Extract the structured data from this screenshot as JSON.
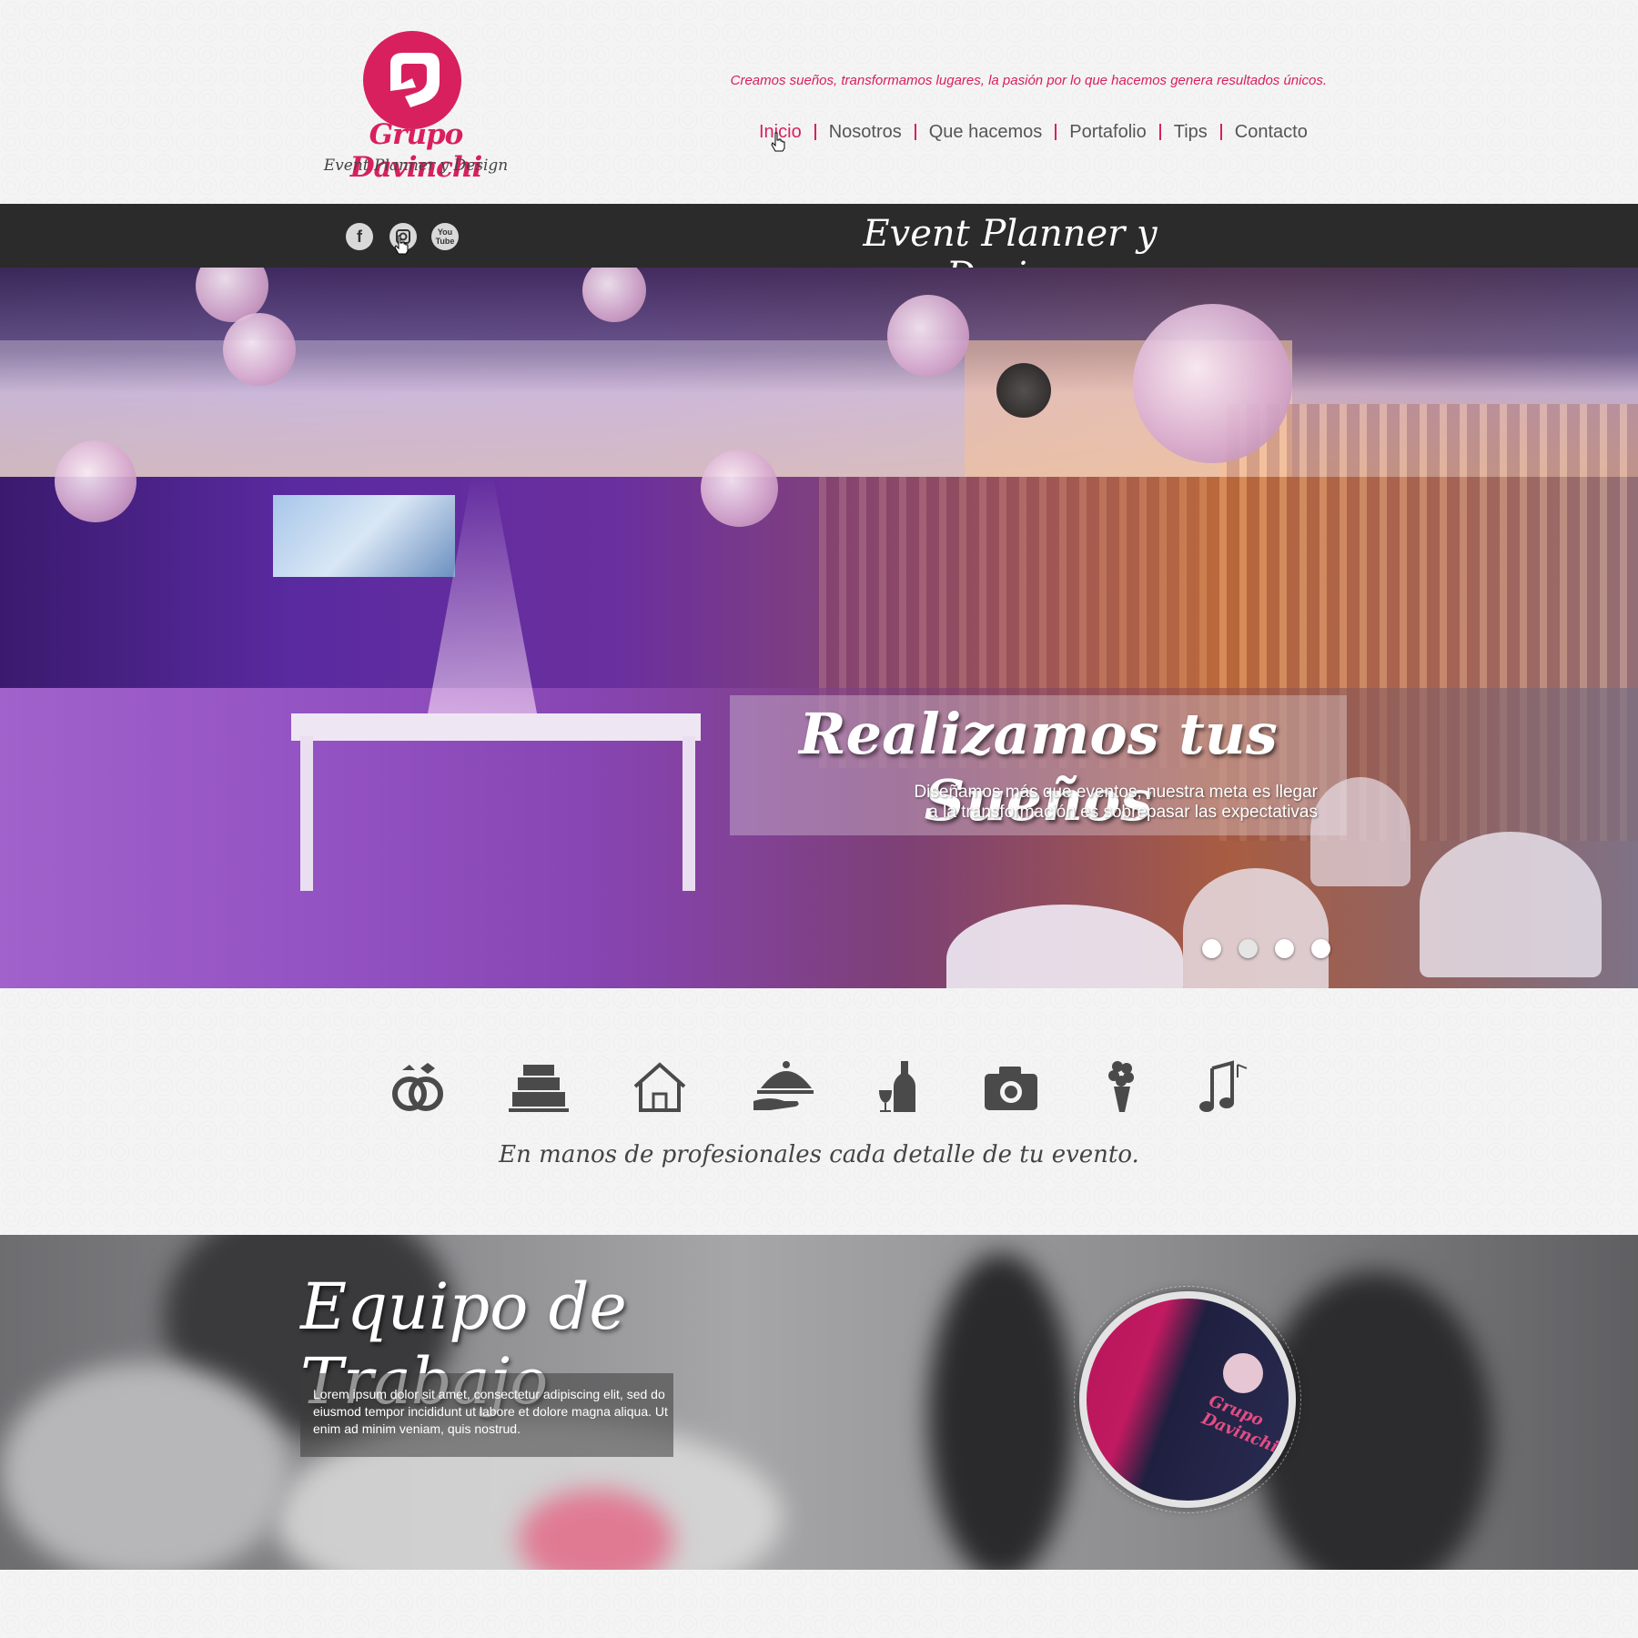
{
  "brand": {
    "name": "Grupo Davinchi",
    "subtitle": "Event Planner y Design",
    "accent_color": "#d8205f"
  },
  "header": {
    "tagline": "Creamos sueños, transformamos lugares, la pasión por lo que hacemos genera resultados únicos.",
    "nav": [
      {
        "label": "Inicio",
        "active": true
      },
      {
        "label": "Nosotros",
        "active": false
      },
      {
        "label": "Que hacemos",
        "active": false
      },
      {
        "label": "Portafolio",
        "active": false
      },
      {
        "label": "Tips",
        "active": false
      },
      {
        "label": "Contacto",
        "active": false
      }
    ]
  },
  "topbar": {
    "title": "Event  Planner y Design",
    "social": [
      {
        "icon": "facebook-icon",
        "glyph": "f"
      },
      {
        "icon": "instagram-icon",
        "glyph": ""
      },
      {
        "icon": "youtube-icon",
        "glyph": "You Tube"
      }
    ]
  },
  "hero": {
    "title": "Realizamos tus Sueños",
    "text_line1": "Diseñamos más que eventos, nuestra meta es llegar",
    "text_line2": "a la transformación es sobrepasar las expectativas",
    "slides": 4,
    "active_slide": 0
  },
  "services": {
    "icons": [
      "wedding-rings-icon",
      "cake-icon",
      "house-icon",
      "catering-cloche-icon",
      "wine-icon",
      "camera-icon",
      "flowers-icon",
      "music-icon"
    ],
    "caption": "En manos de profesionales cada detalle de tu evento."
  },
  "team": {
    "title": "Equipo de Trabajo",
    "text": "Lorem ipsum dolor sit amet, consectetur adipiscing elit, sed do eiusmod tempor incididunt ut labore et dolore magna aliqua. Ut enim ad minim veniam, quis nostrud.",
    "shirt_logo": "Grupo Davinchi"
  }
}
